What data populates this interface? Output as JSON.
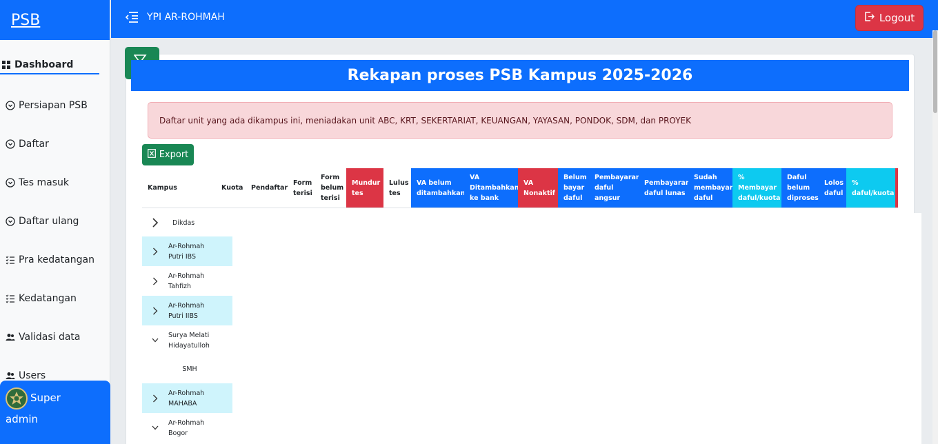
{
  "brand": "PSB",
  "app_title": "YPI AR-ROHMAH",
  "logout_label": "Logout",
  "sidebar": {
    "items": [
      {
        "label": "Dashboard",
        "icon": "grid-icon"
      },
      {
        "label": "Persiapan PSB",
        "icon": "chevron-circle-icon"
      },
      {
        "label": "Daftar",
        "icon": "chevron-circle-icon"
      },
      {
        "label": "Tes masuk",
        "icon": "chevron-circle-icon"
      },
      {
        "label": "Daftar ulang",
        "icon": "chevron-circle-icon"
      },
      {
        "label": "Pra kedatangan",
        "icon": "checklist-icon"
      },
      {
        "label": "Kedatangan",
        "icon": "checklist-icon"
      },
      {
        "label": "Validasi data",
        "icon": "users-icon"
      },
      {
        "label": "Users",
        "icon": "users-icon"
      }
    ]
  },
  "user": {
    "line1": "Super",
    "line2": "admin"
  },
  "page": {
    "title": "Rekapan proses PSB Kampus 2025-2026",
    "alert": "Daftar unit yang ada dikampus ini, meniadakan unit ABC, KRT, SEKERTARIAT, KEUANGAN, YAYASAN, PONDOK, SDM, dan PROYEK",
    "export_label": "Export"
  },
  "table": {
    "headers": [
      "Kampus",
      "Kuota",
      "Pendaftar",
      "Form terisi",
      "Form belum terisi",
      "Mundur tes",
      "Lulus tes",
      "VA belum ditambahkan",
      "VA Ditambahkan ke bank",
      "VA Nonaktif",
      "Belum bayar daful",
      "Pembayaran daful angsur",
      "Pembayaran daful lunas",
      "Sudah membayar daful",
      "% Membayar daful/kuota",
      "Daful belum diproses",
      "Lolos daful",
      "% daful/kuota"
    ],
    "rows": [
      {
        "label": "Dikdas",
        "state": "collapsed"
      },
      {
        "label": "Ar-Rohmah Putri IBS",
        "state": "collapsed"
      },
      {
        "label": "Ar-Rohmah Tahfizh",
        "state": "collapsed"
      },
      {
        "label": "Ar-Rohmah Putri IIBS",
        "state": "collapsed"
      },
      {
        "label": "Surya Melati Hidayatulloh",
        "state": "expanded"
      },
      {
        "label": "SMH",
        "state": "child"
      },
      {
        "label": "Ar-Rohmah MAHABA",
        "state": "collapsed"
      },
      {
        "label": "Ar-Rohmah Bogor",
        "state": "expanded"
      }
    ]
  },
  "colors": {
    "primary": "#0d6efd",
    "danger": "#dc3545",
    "success": "#198754",
    "info": "#0dcaf0"
  }
}
